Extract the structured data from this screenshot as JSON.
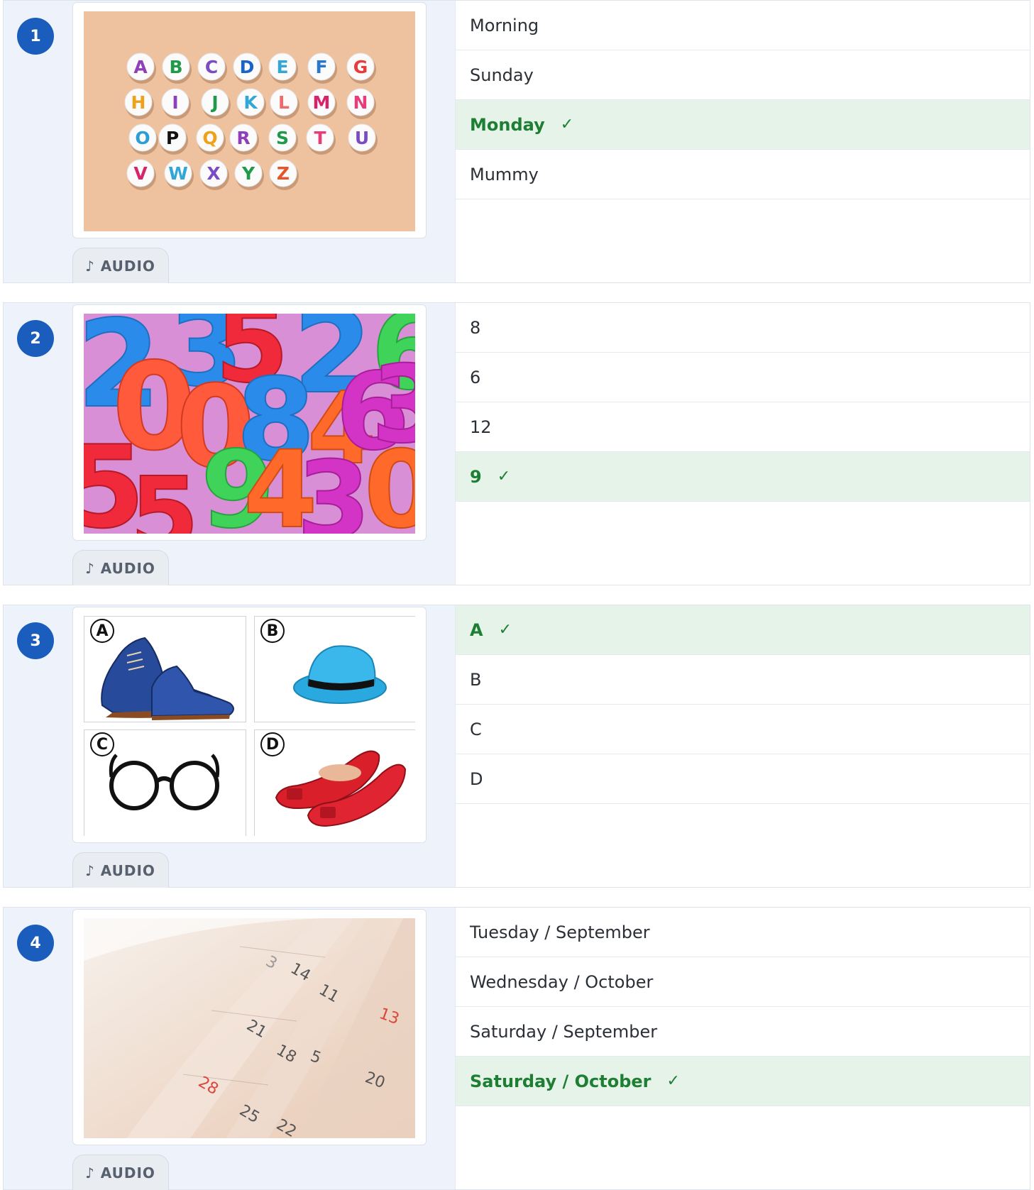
{
  "questions": [
    {
      "number": "1",
      "image_icon": "alphabet-beads-image",
      "audio_label": "AUDIO",
      "options": [
        {
          "label": "Morning",
          "correct": false
        },
        {
          "label": "Sunday",
          "correct": false
        },
        {
          "label": "Monday",
          "correct": true
        },
        {
          "label": "Mummy",
          "correct": false
        }
      ],
      "letters": [
        "A",
        "B",
        "C",
        "D",
        "E",
        "F",
        "G",
        "H",
        "I",
        "J",
        "K",
        "L",
        "M",
        "N",
        "O",
        "P",
        "Q",
        "R",
        "S",
        "T",
        "U",
        "V",
        "W",
        "X",
        "Y",
        "Z"
      ]
    },
    {
      "number": "2",
      "image_icon": "colorful-numbers-image",
      "audio_label": "AUDIO",
      "options": [
        {
          "label": "8",
          "correct": false
        },
        {
          "label": "6",
          "correct": false
        },
        {
          "label": "12",
          "correct": false
        },
        {
          "label": "9",
          "correct": true
        }
      ]
    },
    {
      "number": "3",
      "image_icon": "clothing-grid-image",
      "audio_label": "AUDIO",
      "grid_labels": [
        "A",
        "B",
        "C",
        "D"
      ],
      "options": [
        {
          "label": "A",
          "correct": true
        },
        {
          "label": "B",
          "correct": false
        },
        {
          "label": "C",
          "correct": false
        },
        {
          "label": "D",
          "correct": false
        }
      ]
    },
    {
      "number": "4",
      "image_icon": "calendar-pages-image",
      "audio_label": "AUDIO",
      "options": [
        {
          "label": "Tuesday / September",
          "correct": false
        },
        {
          "label": "Wednesday / October",
          "correct": false
        },
        {
          "label": "Saturday / September",
          "correct": false
        },
        {
          "label": "Saturday / October",
          "correct": true
        }
      ],
      "calendar_numbers": [
        "14",
        "11",
        "13",
        "21",
        "18",
        "5",
        "20",
        "28",
        "25",
        "22",
        "3"
      ]
    }
  ],
  "check_mark": "✓",
  "audio_icon": "♪",
  "colors": {
    "accent": "#1a5dbd",
    "correct_bg": "#e6f3e8",
    "correct_text": "#1e7e34"
  }
}
